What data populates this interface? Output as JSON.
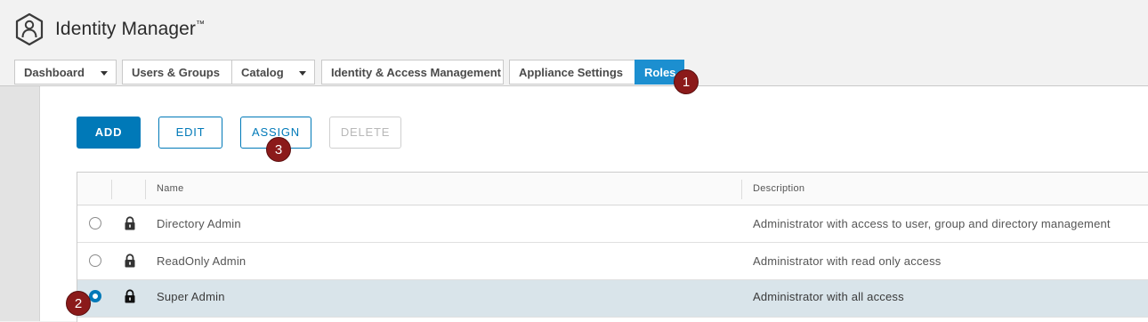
{
  "app": {
    "title": "Identity Manager",
    "trademark": "™",
    "logo_icon": "hexagon-user-icon"
  },
  "nav": {
    "tabs": [
      {
        "label": "Dashboard",
        "has_dropdown": true
      },
      {
        "label": "Users & Groups",
        "has_dropdown": false
      },
      {
        "label": "Catalog",
        "has_dropdown": true
      },
      {
        "label": "Identity & Access Management",
        "has_dropdown": false
      },
      {
        "label": "Appliance Settings",
        "has_dropdown": false
      },
      {
        "label": "Roles",
        "has_dropdown": false,
        "active": true
      }
    ]
  },
  "toolbar": {
    "add_label": "ADD",
    "edit_label": "EDIT",
    "assign_label": "ASSIGN",
    "delete_label": "DELETE",
    "delete_disabled": true
  },
  "grid": {
    "columns": {
      "name": "Name",
      "description": "Description"
    },
    "rows": [
      {
        "name": "Directory Admin",
        "description": "Administrator with access to user, group and directory management",
        "selected": false,
        "locked": true
      },
      {
        "name": "ReadOnly Admin",
        "description": "Administrator with read only access",
        "selected": false,
        "locked": true
      },
      {
        "name": "Super Admin",
        "description": "Administrator with all access",
        "selected": true,
        "locked": true
      }
    ]
  },
  "markers": {
    "m1": "1",
    "m2": "2",
    "m3": "3"
  },
  "colors": {
    "primary": "#0079b8",
    "active_tab": "#1c8fd0",
    "marker": "#8b1a1a",
    "selected_row": "#d9e4ea"
  }
}
